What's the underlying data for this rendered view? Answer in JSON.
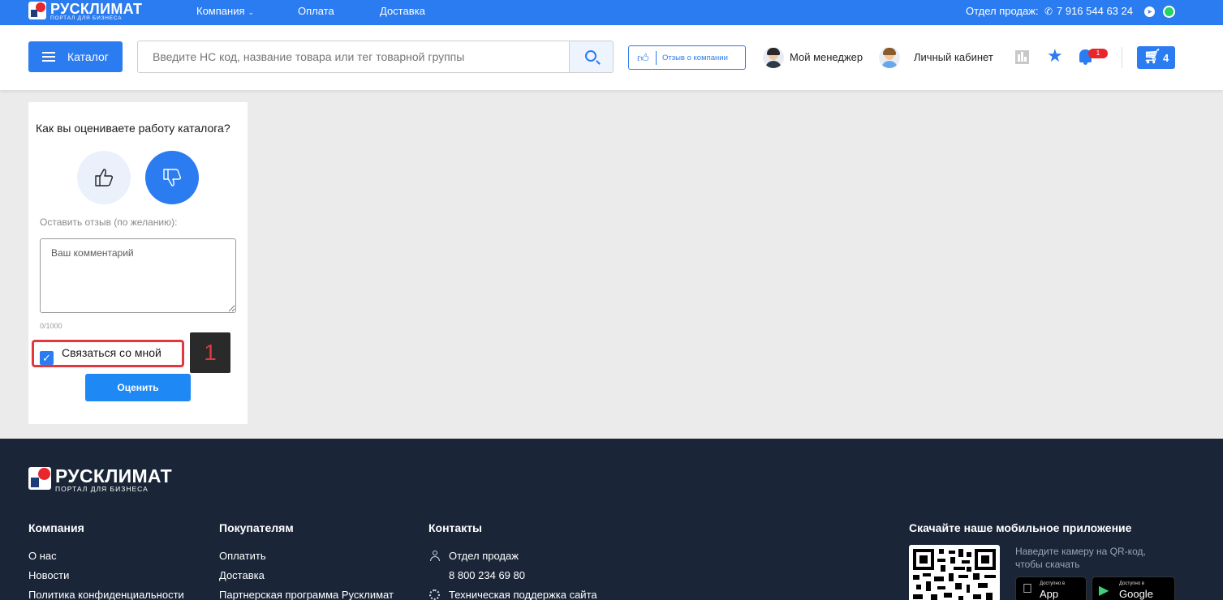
{
  "topbar": {
    "logo_name": "РУСКЛИМАТ",
    "logo_sub": "ПОРТАЛ ДЛЯ БИЗНЕСА",
    "nav": [
      "Компания",
      "Оплата",
      "Доставка"
    ],
    "sales_label": "Отдел продаж:",
    "phone": "7 916 544 63 24"
  },
  "header": {
    "catalog_label": "Каталог",
    "search_placeholder": "Введите НС код, название товара или тег товарной группы",
    "review_label": "Отзыв о компании",
    "manager_label": "Мой менеджер",
    "cabinet_label": "Личный кабинет",
    "notifications_count": "1",
    "cart_count": "4"
  },
  "feedback": {
    "title": "Как вы оцениваете работу каталога?",
    "hint": "Оставить отзыв (по желанию):",
    "comment_placeholder": "Ваш комментарий",
    "counter": "0/1000",
    "contact_label": "Связаться со мной",
    "contact_checked": true,
    "submit_label": "Оценить",
    "selected_vote": "dislike"
  },
  "annotation": {
    "marker": "1"
  },
  "footer": {
    "logo_name": "РУСКЛИМАТ",
    "logo_sub": "ПОРТАЛ ДЛЯ БИЗНЕСА",
    "company": {
      "title": "Компания",
      "links": [
        "О нас",
        "Новости",
        "Политика конфиденциальности"
      ]
    },
    "buyers": {
      "title": "Покупателям",
      "links": [
        "Оплатить",
        "Доставка",
        "Партнерская программа Русклимат"
      ]
    },
    "contacts": {
      "title": "Контакты",
      "sales_label": "Отдел продаж",
      "sales_phone": "8 800 234 69 80",
      "support_label": "Техническая поддержка сайта"
    },
    "app": {
      "title": "Скачайте наше мобильное приложение",
      "hint": "Наведите камеру на QR-код, чтобы скачать",
      "appstore_small": "Доступно в",
      "appstore_name": "App Store",
      "gplay_small": "Доступно в",
      "gplay_name": "Google Play"
    }
  },
  "colors": {
    "accent": "#2b7cf0",
    "footer_bg": "#1a2638",
    "highlight": "#e0383e",
    "page_bg": "#ebebeb"
  }
}
